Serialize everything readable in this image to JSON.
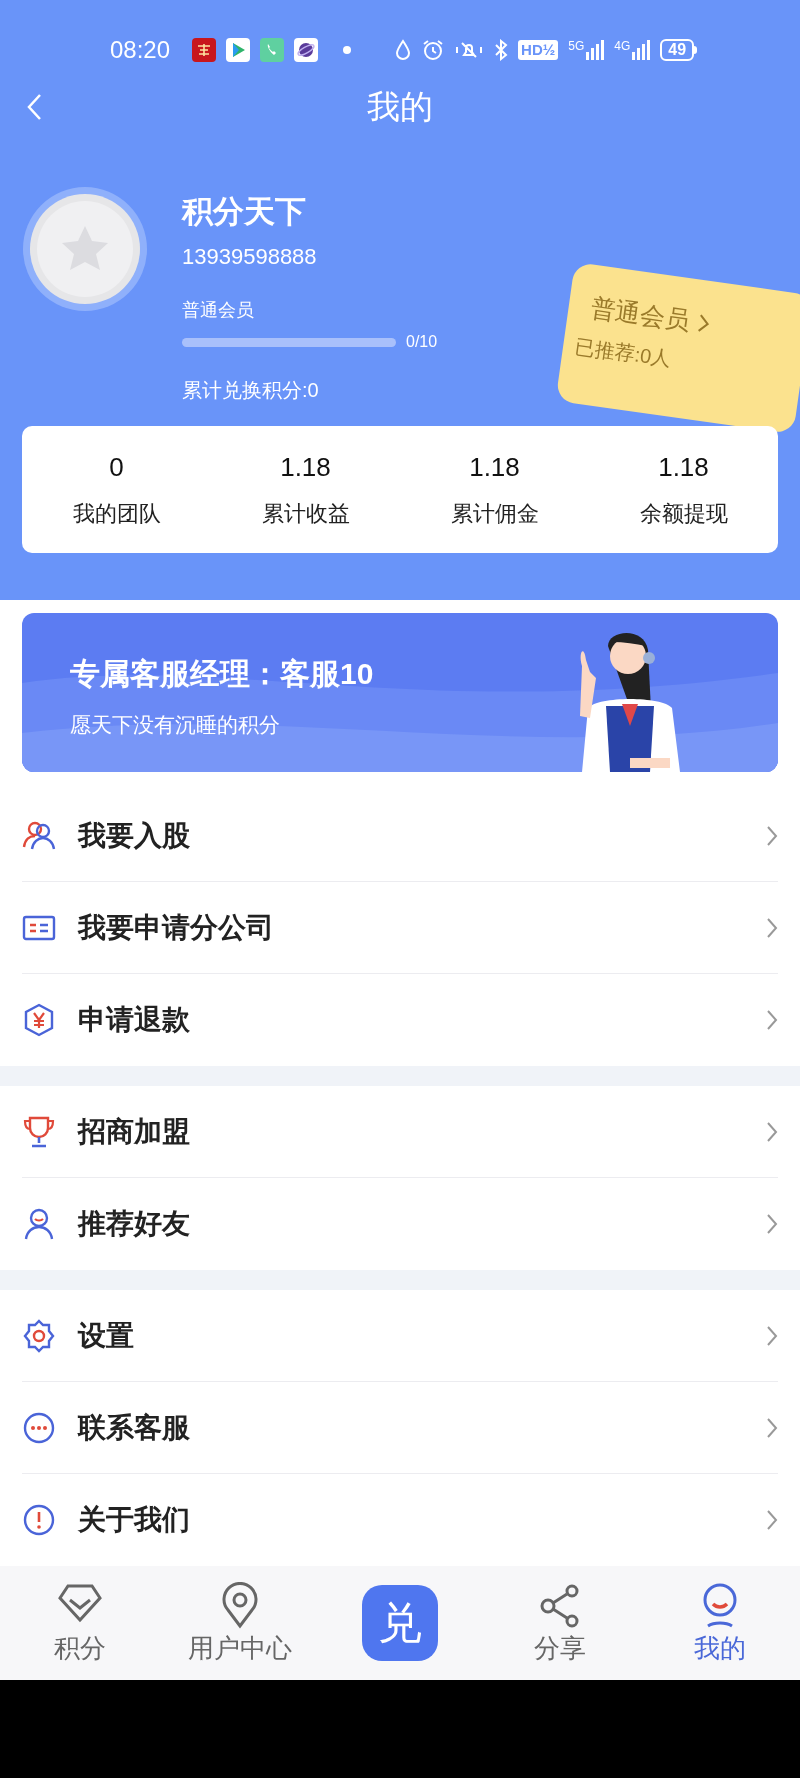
{
  "status_bar": {
    "time": "08:20",
    "hd_badge": "HD½",
    "networks": [
      "5G",
      "4G"
    ],
    "battery": "49"
  },
  "header": {
    "title": "我的"
  },
  "profile": {
    "name": "积分天下",
    "phone": "13939598888",
    "level_label": "普通会员",
    "progress": {
      "level": 0,
      "reading": "0/10"
    },
    "points_total": "累计兑换积分:0"
  },
  "member_card": {
    "title": "普通会员",
    "referred": "已推荐:0人"
  },
  "stats": [
    {
      "value": "0",
      "label": "我的团队"
    },
    {
      "value": "1.18",
      "label": "累计收益"
    },
    {
      "value": "1.18",
      "label": "累计佣金"
    },
    {
      "value": "1.18",
      "label": "余额提现"
    }
  ],
  "banner": {
    "title": "专属客服经理：客服10",
    "subtitle": "愿天下没有沉睡的积分"
  },
  "menu_groups": [
    [
      {
        "label": "我要入股"
      },
      {
        "label": "我要申请分公司"
      },
      {
        "label": "申请退款"
      }
    ],
    [
      {
        "label": "招商加盟"
      },
      {
        "label": "推荐好友"
      }
    ],
    [
      {
        "label": "设置"
      },
      {
        "label": "联系客服"
      },
      {
        "label": "关于我们"
      }
    ]
  ],
  "bottom_nav": [
    {
      "kind": "tab",
      "label": "积分",
      "selected": false
    },
    {
      "kind": "tab",
      "label": "用户中心",
      "selected": false
    },
    {
      "kind": "center",
      "glyph": "兑",
      "selected": false
    },
    {
      "kind": "tab",
      "label": "分享",
      "selected": false
    },
    {
      "kind": "tab",
      "label": "我的",
      "selected": true
    }
  ]
}
